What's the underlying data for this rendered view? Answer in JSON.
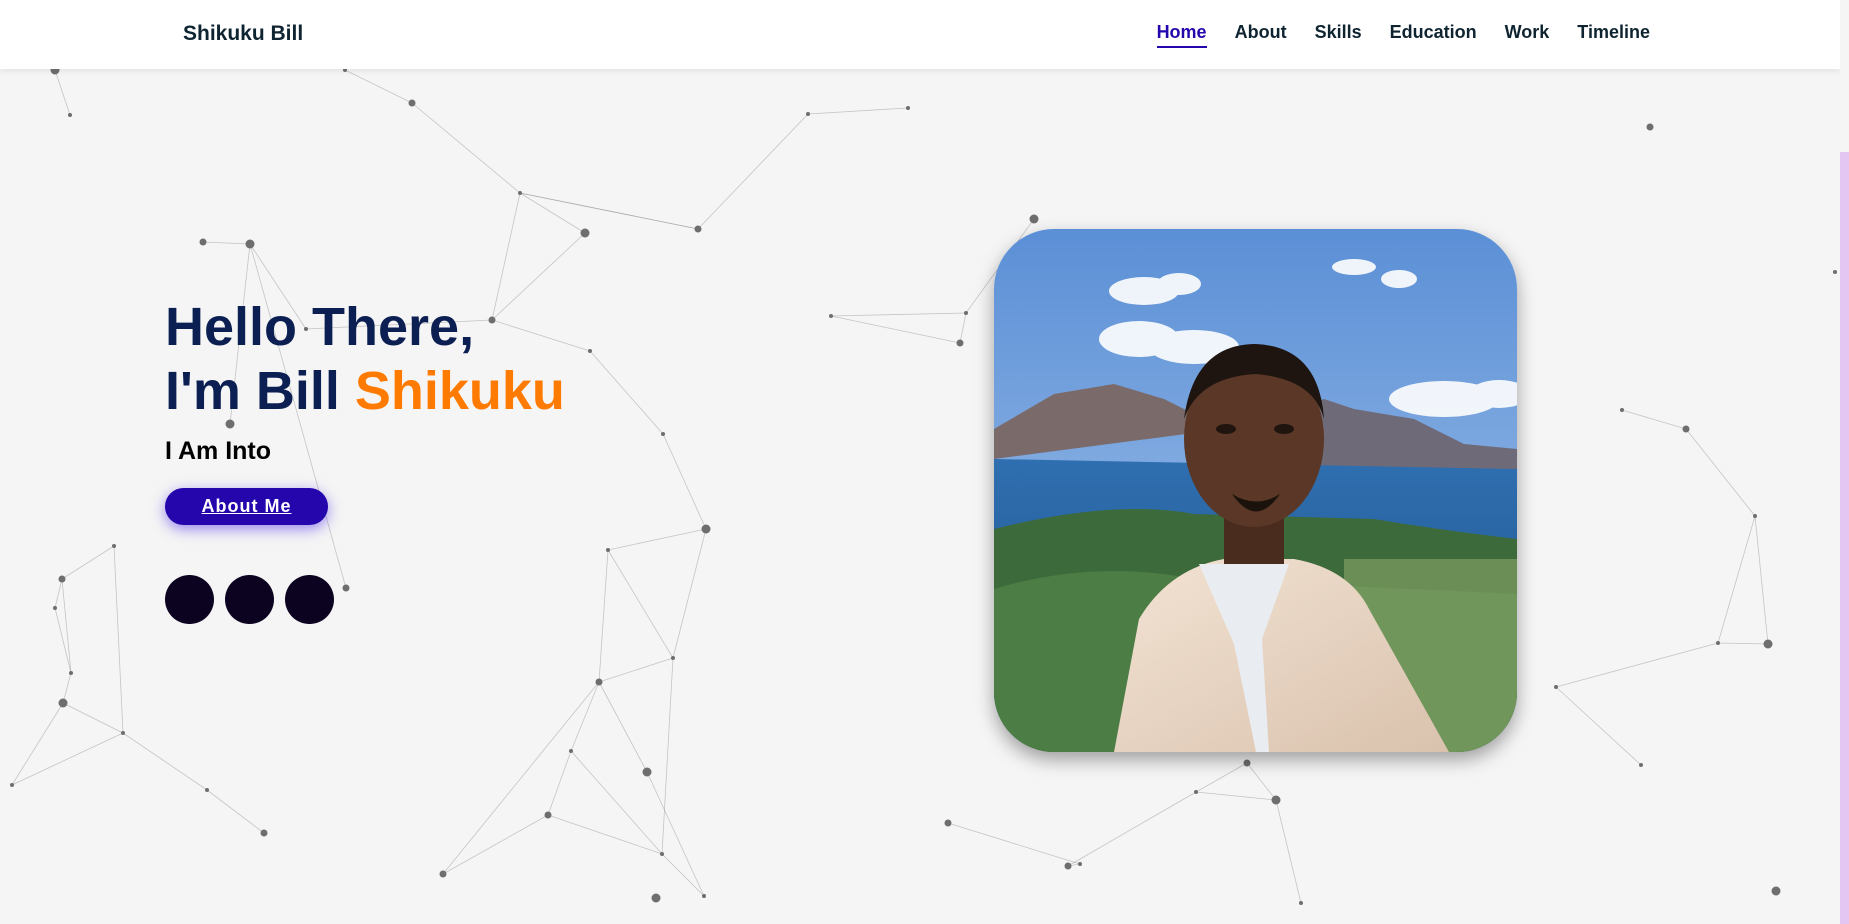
{
  "brand": "Shikuku Bill",
  "nav": {
    "items": [
      {
        "label": "Home",
        "active": true
      },
      {
        "label": "About",
        "active": false
      },
      {
        "label": "Skills",
        "active": false
      },
      {
        "label": "Education",
        "active": false
      },
      {
        "label": "Work",
        "active": false
      },
      {
        "label": "Timeline",
        "active": false
      }
    ]
  },
  "hero": {
    "line1": "Hello There,",
    "line2_prefix": "I'm Bill ",
    "line2_highlight": "Shikuku",
    "subtitle": "I Am Into",
    "button_label": "About Me",
    "social_icons": [
      "social-icon-1",
      "social-icon-2",
      "social-icon-3"
    ]
  },
  "colors": {
    "brand_text": "#0e2431",
    "accent_blue": "#2506ad",
    "title_navy": "#0b1f52",
    "highlight_orange": "#ff7a00",
    "background": "#f5f5f5",
    "social_dark": "#0b0320",
    "scrollbar": "#e3c6f2"
  },
  "portrait": {
    "description_icon": "profile-photo"
  }
}
